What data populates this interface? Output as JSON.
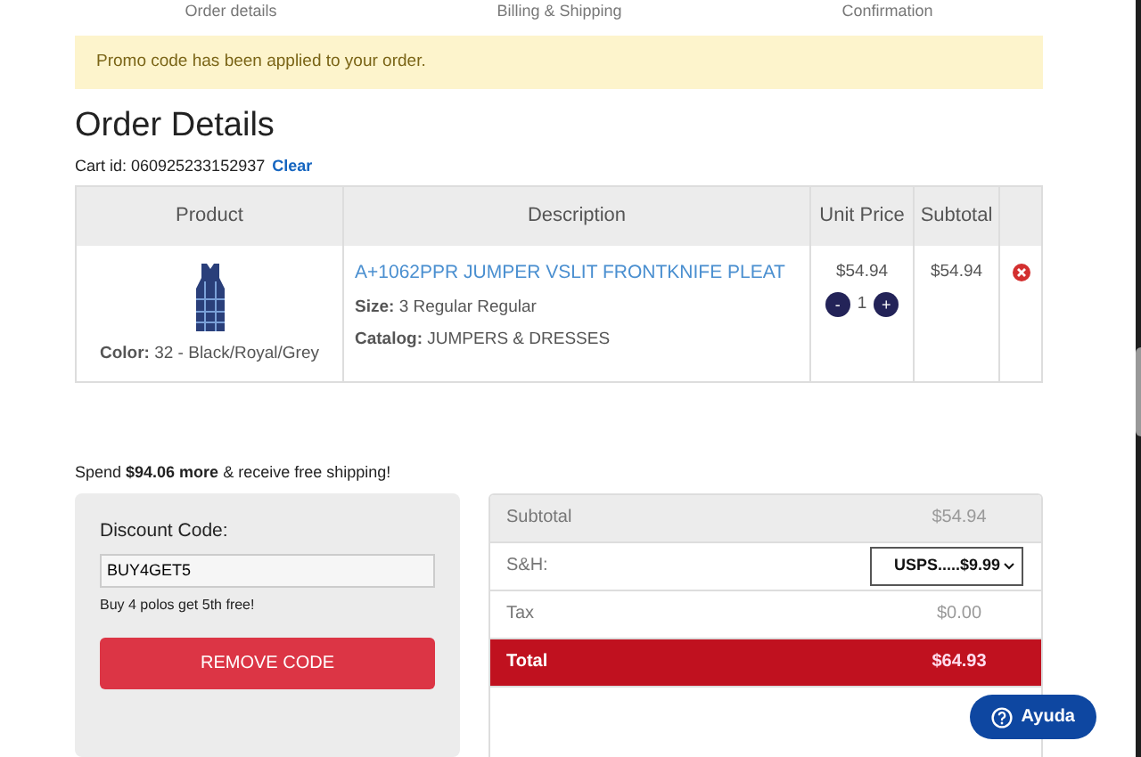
{
  "steps": [
    "Order details",
    "Billing & Shipping",
    "Confirmation"
  ],
  "alert": "Promo code has been applied to your order.",
  "heading": "Order Details",
  "cart": {
    "label": "Cart id: 060925233152937",
    "clear": "Clear"
  },
  "table": {
    "columns": [
      "Product",
      "Description",
      "Unit Price",
      "Subtotal"
    ],
    "rows": [
      {
        "color_label": "Color:",
        "color_value": "32 - Black/Royal/Grey",
        "title": "A+1062PPR JUMPER VSLIT FRONTKNIFE PLEAT",
        "size_label": "Size:",
        "size_value": "3 Regular Regular",
        "catalog_label": "Catalog:",
        "catalog_value": "JUMPERS & DRESSES",
        "unit_price": "$54.94",
        "minus": "-",
        "quantity": "1",
        "plus": "+",
        "subtotal": "$54.94"
      }
    ]
  },
  "shipping_note": "Spend **$94.06 more** & receive free shipping!",
  "discount": {
    "label": "Discount Code:",
    "value": "BUY4GET5",
    "note": "Buy 4 polos get 5th free!",
    "button": "REMOVE CODE"
  },
  "summary": [
    {
      "kind": "subtotal",
      "label": "Subtotal",
      "value": "$54.94"
    },
    {
      "kind": "select",
      "label": "S&H:",
      "value": "USPS.....$9.99"
    },
    {
      "kind": "plain",
      "label": "Tax",
      "value": "$0.00"
    },
    {
      "kind": "total",
      "label": "Total",
      "value": "$64.93"
    }
  ],
  "help_button": "Ayuda"
}
